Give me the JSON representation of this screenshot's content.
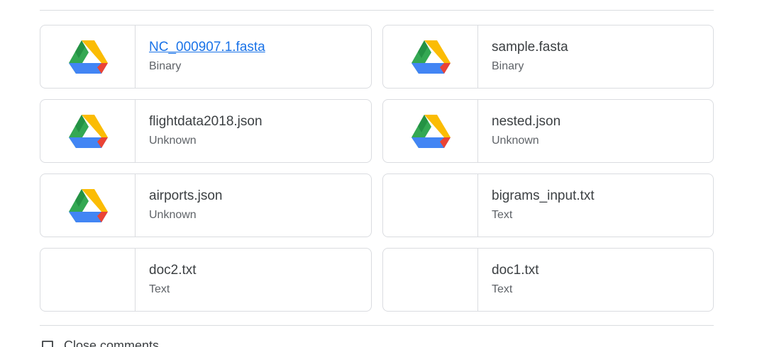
{
  "files": [
    {
      "name": "NC_000907.1.fasta",
      "type": "Binary",
      "icon": "google-drive-icon",
      "link": true
    },
    {
      "name": "sample.fasta",
      "type": "Binary",
      "icon": "google-drive-icon",
      "link": false
    },
    {
      "name": "flightdata2018.json",
      "type": "Unknown",
      "icon": "google-drive-icon",
      "link": false
    },
    {
      "name": "nested.json",
      "type": "Unknown",
      "icon": "google-drive-icon",
      "link": false
    },
    {
      "name": "airports.json",
      "type": "Unknown",
      "icon": "google-drive-icon",
      "link": false
    },
    {
      "name": "bigrams_input.txt",
      "type": "Text",
      "icon": "",
      "link": false
    },
    {
      "name": "doc2.txt",
      "type": "Text",
      "icon": "",
      "link": false
    },
    {
      "name": "doc1.txt",
      "type": "Text",
      "icon": "",
      "link": false
    }
  ],
  "footer": {
    "close_comments_label": "Close comments",
    "icon": "comment-icon"
  },
  "colors": {
    "link": "#1a73e8",
    "border": "#dadce0",
    "text": "#3c4043",
    "secondary_text": "#5f6368",
    "drive_green": "#34a853",
    "drive_yellow": "#fbbc04",
    "drive_blue": "#4285f4",
    "drive_red": "#ea4335",
    "drive_dark_green": "#188038"
  }
}
